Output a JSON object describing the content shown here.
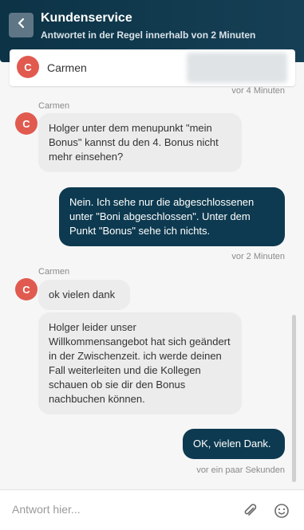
{
  "header": {
    "title": "Kundenservice",
    "subtitle": "Antwortet in der Regel innerhalb von 2 Minuten",
    "back_icon": "chevron-left-icon"
  },
  "agent": {
    "initial": "C",
    "name": "Carmen",
    "avatar_color": "#e15a4f"
  },
  "messages": [
    {
      "direction": "meta",
      "time": "vor 4 Minuten"
    },
    {
      "direction": "in",
      "sender": "Carmen",
      "text": "Holger unter dem menupunkt \"mein Bonus\" kannst du den 4. Bonus nicht mehr einsehen?"
    },
    {
      "direction": "out",
      "text": "Nein. Ich sehe nur die abgeschlossenen unter \"Boni abgeschlossen\". Unter dem Punkt \"Bonus\" sehe ich nichts.",
      "time": "vor 2 Minuten"
    },
    {
      "direction": "in",
      "sender": "Carmen",
      "text": "ok vielen dank"
    },
    {
      "direction": "in",
      "text": "Holger leider unser Willkommensangebot hat sich geändert in der Zwischenzeit. ich werde deinen Fall weiterleiten und die Kollegen schauen ob sie dir den Bonus nachbuchen können."
    },
    {
      "direction": "out",
      "text": "OK, vielen Dank.",
      "time": "vor ein paar Sekunden"
    }
  ],
  "composer": {
    "placeholder": "Antwort hier...",
    "attach_icon": "paperclip-icon",
    "emoji_icon": "smiley-icon"
  },
  "colors": {
    "header_bg": "#0c3346",
    "outgoing_bubble": "#0d3a50",
    "incoming_bubble": "#ececec"
  }
}
